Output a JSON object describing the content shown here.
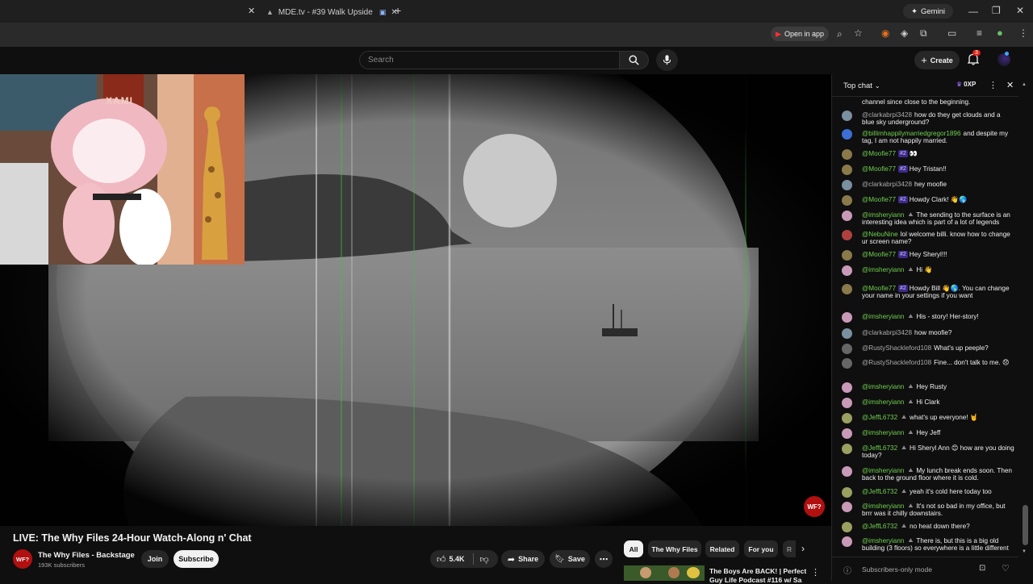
{
  "browser": {
    "active_tab_title": "MDE.tv - #39 Walk Upside",
    "gemini_label": "Gemini",
    "open_in_app_label": "Open in app"
  },
  "header": {
    "search_placeholder": "Search",
    "create_label": "Create",
    "notification_count": "3"
  },
  "video": {
    "title": "LIVE: The Why Files 24-Hour Watch-Along n' Chat",
    "channel_name": "The Why Files - Backstage",
    "subscribers": "193K subscribers",
    "join_label": "Join",
    "subscribe_label": "Subscribe",
    "likes": "5.4K",
    "share_label": "Share",
    "save_label": "Save",
    "webcam_sign": "XAMI",
    "watermark": "WF?"
  },
  "filters": [
    "All",
    "The Why Files",
    "Related",
    "For you",
    "R"
  ],
  "recommendation": {
    "title_line1": "The Boys Are BACK! | Perfect",
    "title_line2": "Guy Life Podcast #116 w/ Sa"
  },
  "chat": {
    "mode_label": "Top chat",
    "points": "0XP",
    "footer_label": "Subscribers-only mode",
    "messages": [
      {
        "author": "",
        "text": "channel since close to the beginning.",
        "color": "#444"
      },
      {
        "author": "@clarkabrpi3428",
        "plain": true,
        "text": "how do they get clouds and a blue sky underground?",
        "color": "#7a8fa0"
      },
      {
        "author": "@billimhappilymarriedgregor1896",
        "text": "and despite my tag, I am not happily married.",
        "color": "#3b6fd6"
      },
      {
        "author": "@Moofie77",
        "rank": "#2",
        "text": "👀",
        "color": "#8a7a4a"
      },
      {
        "author": "@Moofie77",
        "rank": "#2",
        "text": "Hey Tristan!!",
        "color": "#8a7a4a"
      },
      {
        "author": "@clarkabrpi3428",
        "plain": true,
        "text": "hey moofie",
        "color": "#7a8fa0"
      },
      {
        "author": "@Moofie77",
        "rank": "#2",
        "text": "Howdy Clark! 👋🌎",
        "color": "#8a7a4a"
      },
      {
        "author": "@imsheryiann",
        "mod": true,
        "text": "The sending to the surface is an interesting idea which is part of a lot of legends",
        "color": "#c99ab8"
      },
      {
        "author": "@NebuNine",
        "text": "lol welcome billi. know how to change ur screen name?",
        "color": "#b04040"
      },
      {
        "author": "@Moofie77",
        "rank": "#2",
        "text": "Hey Sheryl!!!",
        "color": "#8a7a4a"
      },
      {
        "author": "@imsheryiann",
        "mod": true,
        "text": "Hi 👋",
        "color": "#c99ab8"
      },
      {
        "author": "@Moofie77",
        "rank": "#2",
        "text": "Howdy Bill 👋🌎. You can change your name in your settings if you want",
        "color": "#8a7a4a"
      },
      {
        "author": "@imsheryiann",
        "mod": true,
        "text": "His - story! Her-story!",
        "color": "#c99ab8"
      },
      {
        "author": "@clarkabrpi3428",
        "plain": true,
        "text": "how moofie?",
        "color": "#7a8fa0"
      },
      {
        "author": "@RustyShackleford108",
        "plain": true,
        "text": "What's up peeple?",
        "color": "#666"
      },
      {
        "author": "@RustyShackleford108",
        "plain": true,
        "text": "Fine... don't talk to me. 😞",
        "color": "#666"
      },
      {
        "author": "@imsheryiann",
        "mod": true,
        "text": "Hey Rusty",
        "color": "#c99ab8"
      },
      {
        "author": "@imsheryiann",
        "mod": true,
        "text": "Hi Clark",
        "color": "#c99ab8"
      },
      {
        "author": "@JeffL6732",
        "mod": true,
        "text": "what's up everyone! 🤘",
        "color": "#9aa060"
      },
      {
        "author": "@imsheryiann",
        "mod": true,
        "text": "Hey Jeff",
        "color": "#c99ab8"
      },
      {
        "author": "@JeffL6732",
        "mod": true,
        "text": "Hi Sheryl Ann 😊 how are you doing today?",
        "color": "#9aa060"
      },
      {
        "author": "@imsheryiann",
        "mod": true,
        "text": "My lunch break ends soon. Then back to the ground floor where it is cold.",
        "color": "#c99ab8"
      },
      {
        "author": "@JeffL6732",
        "mod": true,
        "text": "yeah it's cold here today too",
        "color": "#9aa060"
      },
      {
        "author": "@imsheryiann",
        "mod": true,
        "text": "It's not so bad in my office, but brrr was it chilly downstairs.",
        "color": "#c99ab8"
      },
      {
        "author": "@JeffL6732",
        "mod": true,
        "text": "no heat down there?",
        "color": "#9aa060"
      },
      {
        "author": "@imsheryiann",
        "mod": true,
        "text": "There is, but this is a big old building (3 floors) so everywhere is a little different",
        "color": "#c99ab8"
      }
    ]
  }
}
